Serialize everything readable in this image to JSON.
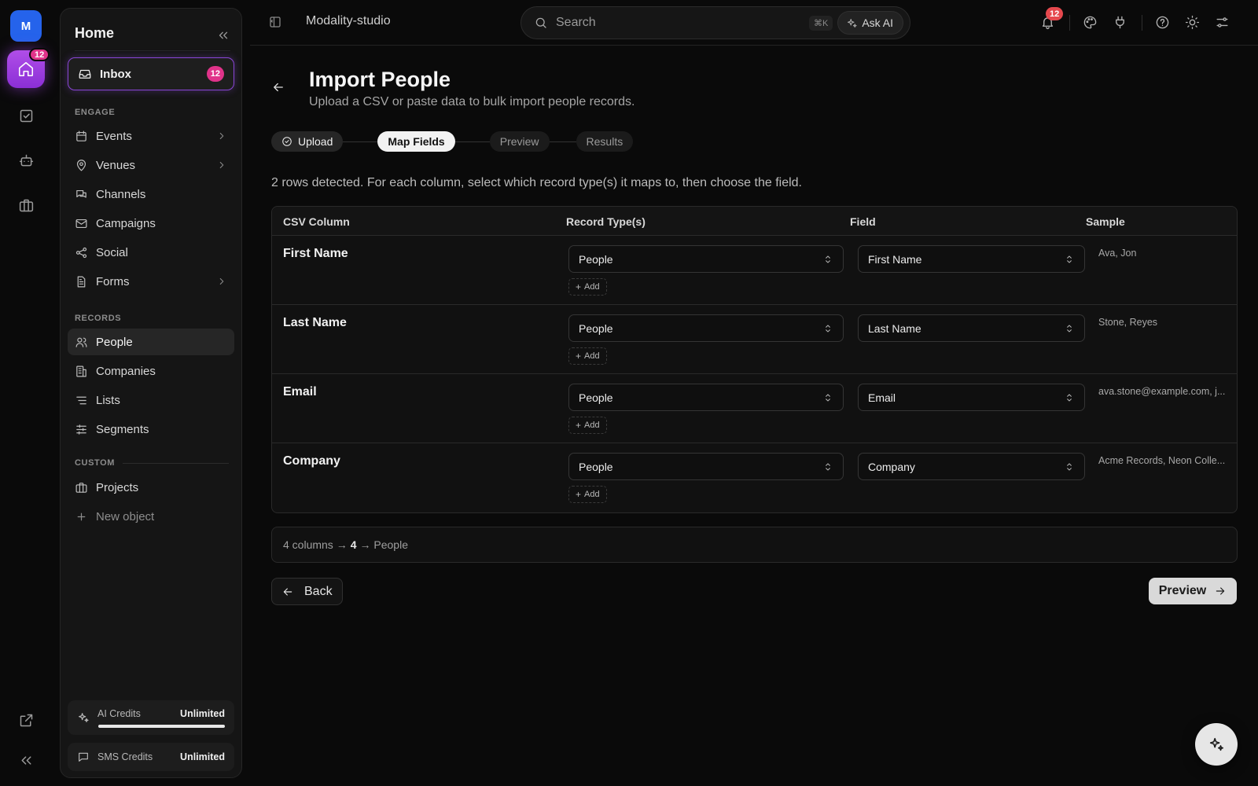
{
  "rail": {
    "avatar_letter": "M",
    "home_badge": "12"
  },
  "sidebar": {
    "title": "Home",
    "inbox": {
      "label": "Inbox",
      "count": "12"
    },
    "sections": {
      "engage": "ENGAGE",
      "records": "RECORDS",
      "custom": "CUSTOM"
    },
    "engage_items": [
      {
        "label": "Events",
        "icon": "calendar-icon",
        "has_submenu": true
      },
      {
        "label": "Venues",
        "icon": "map-pin-icon",
        "has_submenu": true
      },
      {
        "label": "Channels",
        "icon": "chat-icon",
        "has_submenu": false
      },
      {
        "label": "Campaigns",
        "icon": "mail-icon",
        "has_submenu": false
      },
      {
        "label": "Social",
        "icon": "share-icon",
        "has_submenu": false
      },
      {
        "label": "Forms",
        "icon": "document-icon",
        "has_submenu": true
      }
    ],
    "record_items": [
      {
        "label": "People",
        "icon": "users-icon",
        "active": true
      },
      {
        "label": "Companies",
        "icon": "building-icon",
        "active": false
      },
      {
        "label": "Lists",
        "icon": "list-icon",
        "active": false
      },
      {
        "label": "Segments",
        "icon": "sliders-icon",
        "active": false
      }
    ],
    "custom_items": [
      {
        "label": "Projects",
        "icon": "briefcase-icon"
      },
      {
        "label": "New object",
        "icon": "plus-icon"
      }
    ],
    "credits": [
      {
        "label": "AI Credits",
        "value": "Unlimited",
        "level": 1.0
      },
      {
        "label": "SMS Credits",
        "value": "Unlimited"
      }
    ]
  },
  "topbar": {
    "workspace": "Modality-studio",
    "search_placeholder": "Search",
    "shortcut": "⌘K",
    "ask_ai": "Ask AI",
    "notification_count": "12"
  },
  "page": {
    "title": "Import People",
    "subtitle": "Upload a CSV or paste data to bulk import people records.",
    "steps": [
      {
        "label": "Upload",
        "state": "done"
      },
      {
        "label": "Map Fields",
        "state": "current"
      },
      {
        "label": "Preview",
        "state": "pending"
      },
      {
        "label": "Results",
        "state": "pending"
      }
    ],
    "rows_info": "2 rows detected. For each column, select which record type(s) it maps to, then choose the field.",
    "table": {
      "headers": [
        "CSV Column",
        "Record Type(s)",
        "Field",
        "Sample"
      ],
      "add_label": "Add",
      "rows": [
        {
          "column": "First Name",
          "record_type": "People",
          "field": "First Name",
          "sample": "Ava, Jon"
        },
        {
          "column": "Last Name",
          "record_type": "People",
          "field": "Last Name",
          "sample": "Stone, Reyes"
        },
        {
          "column": "Email",
          "record_type": "People",
          "field": "Email",
          "sample": "ava.stone@example.com, j..."
        },
        {
          "column": "Company",
          "record_type": "People",
          "field": "Company",
          "sample": "Acme Records, Neon Colle..."
        }
      ]
    },
    "summary": {
      "columns": "4 columns →",
      "count": "4",
      "target": "→ People"
    },
    "back_label": "Back",
    "next_label": "Preview"
  },
  "colors": {
    "accent": "#8b2fd6",
    "badge": "#e0338a",
    "notification": "#e5484d",
    "rail_avatar": "#2563eb"
  }
}
